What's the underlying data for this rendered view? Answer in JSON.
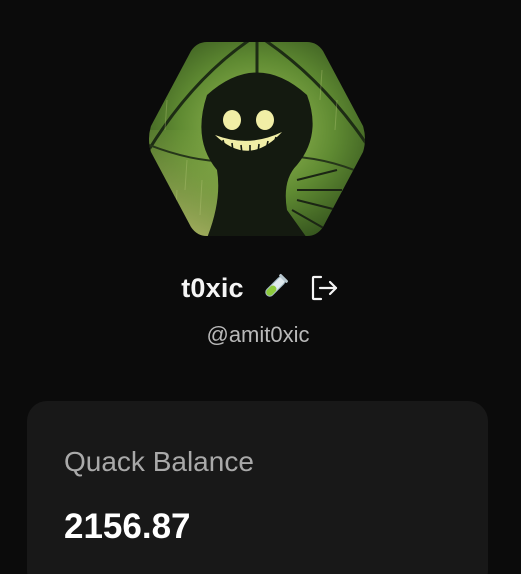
{
  "profile": {
    "username": "t0xic",
    "handle": "@amit0xic",
    "avatar_alt": "profile-avatar",
    "badge_icon": "test-tube-icon",
    "logout_icon": "logout-icon"
  },
  "balance": {
    "label": "Quack Balance",
    "value": "2156.87"
  },
  "colors": {
    "background": "#0b0b0b",
    "card": "#181818",
    "muted_text": "#a9a9a9",
    "avatar_green": "#6f9a3a"
  }
}
